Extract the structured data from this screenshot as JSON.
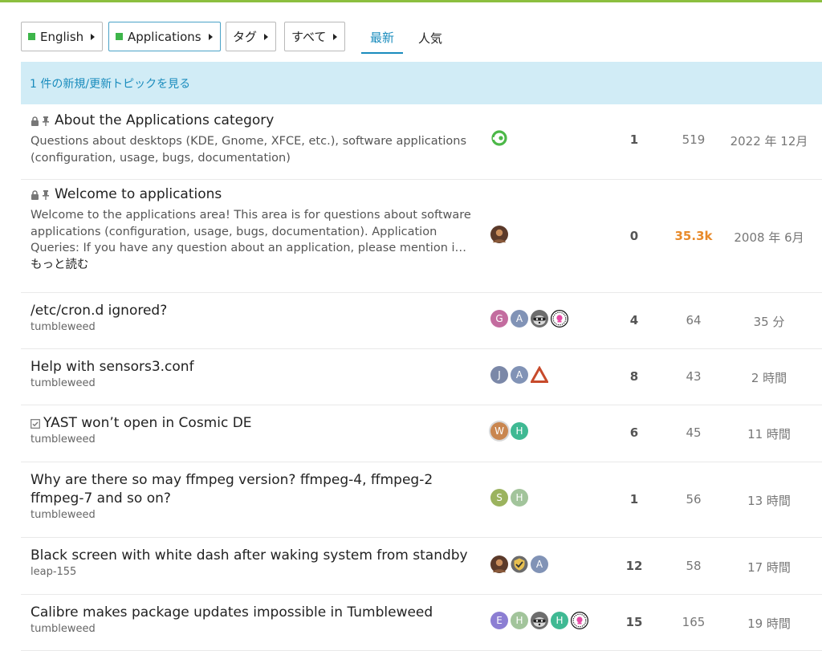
{
  "nav": {
    "language": {
      "label": "English",
      "color": "#3db54a"
    },
    "category": {
      "label": "Applications",
      "color": "#3db54a"
    },
    "tags_label": "タグ",
    "all_label": "すべて",
    "tabs": [
      {
        "label": "最新",
        "active": true
      },
      {
        "label": "人気",
        "active": false
      }
    ]
  },
  "banner": {
    "text": "1 件の新規/更新トピックを見る"
  },
  "colors": {
    "accent": "#1a8cbd",
    "banner_bg": "#d1ecf6",
    "hot_views": "#e88a2a",
    "top_border": "#8cbf3f"
  },
  "topics": [
    {
      "title": "About the Applications category",
      "pinned": true,
      "locked": true,
      "excerpt": "Questions about desktops (KDE, Gnome, XFCE, etc.), software applications (configuration, usage, bugs, documentation)",
      "posters": [
        {
          "type": "icon",
          "icon": "opensuse-logo-icon"
        }
      ],
      "replies": "1",
      "views": "519",
      "activity": "2022 年 12月"
    },
    {
      "title": "Welcome to applications",
      "pinned": true,
      "locked": true,
      "excerpt": "Welcome to the applications area! This area is for questions about software applications (configuration, usage, bugs, documentation). Application Queries: If you have any question about an application, please mention i…",
      "read_more": "もっと読む",
      "posters": [
        {
          "type": "photo",
          "icon": "user-photo-avatar"
        }
      ],
      "replies": "0",
      "views": "35.3k",
      "views_hot": true,
      "activity": "2008 年 6月"
    },
    {
      "title": "/etc/cron.d ignored?",
      "tag": "tumbleweed",
      "posters": [
        {
          "type": "letter",
          "letter": "G",
          "color": "#c36c9f"
        },
        {
          "type": "letter",
          "letter": "A",
          "color": "#8193b6"
        },
        {
          "type": "icon",
          "icon": "raccoon-avatar-icon"
        },
        {
          "type": "icon",
          "icon": "pink-emblem-avatar-icon"
        }
      ],
      "replies": "4",
      "views": "64",
      "activity": "35 分"
    },
    {
      "title": "Help with sensors3.conf",
      "tag": "tumbleweed",
      "posters": [
        {
          "type": "letter",
          "letter": "J",
          "color": "#7b88a8"
        },
        {
          "type": "letter",
          "letter": "A",
          "color": "#8193b6"
        },
        {
          "type": "icon",
          "icon": "triangle-avatar-icon"
        }
      ],
      "replies": "8",
      "views": "43",
      "activity": "2 時間"
    },
    {
      "title": "YAST won’t open in Cosmic DE",
      "solved": true,
      "tag": "tumbleweed",
      "posters": [
        {
          "type": "letter",
          "letter": "W",
          "color": "#c9864f",
          "ring": true
        },
        {
          "type": "letter",
          "letter": "H",
          "color": "#3fb993"
        }
      ],
      "replies": "6",
      "views": "45",
      "activity": "11 時間"
    },
    {
      "title": "Why are there so may ffmpeg version? ffmpeg-4, ffmpeg-2 ffmpeg-7 and so on?",
      "tag": "tumbleweed",
      "posters": [
        {
          "type": "letter",
          "letter": "S",
          "color": "#9bb35e"
        },
        {
          "type": "letter",
          "letter": "H",
          "color": "#a2c49b"
        }
      ],
      "replies": "1",
      "views": "56",
      "activity": "13 時間"
    },
    {
      "title": "Black screen with white dash after waking system from standby",
      "tag": "leap-155",
      "posters": [
        {
          "type": "photo",
          "icon": "user-photo-avatar"
        },
        {
          "type": "icon",
          "icon": "shield-avatar-icon"
        },
        {
          "type": "letter",
          "letter": "A",
          "color": "#8193b6"
        }
      ],
      "replies": "12",
      "views": "58",
      "activity": "17 時間"
    },
    {
      "title": "Calibre makes package updates impossible in Tumbleweed",
      "tag": "tumbleweed",
      "posters": [
        {
          "type": "letter",
          "letter": "E",
          "color": "#8c7ed3"
        },
        {
          "type": "letter",
          "letter": "H",
          "color": "#a2c49b"
        },
        {
          "type": "icon",
          "icon": "raccoon-avatar-icon"
        },
        {
          "type": "letter",
          "letter": "H",
          "color": "#3fb993"
        },
        {
          "type": "icon",
          "icon": "pink-emblem-avatar-icon"
        }
      ],
      "replies": "15",
      "views": "165",
      "activity": "19 時間"
    }
  ]
}
